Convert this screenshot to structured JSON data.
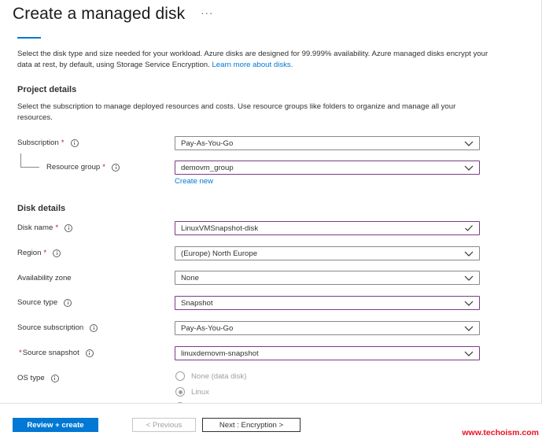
{
  "page": {
    "title": "Create a managed disk",
    "more_label": "···"
  },
  "intro": {
    "text": "Select the disk type and size needed for your workload. Azure disks are designed for 99.999% availability. Azure managed disks encrypt your data at rest, by default, using Storage Service Encryption.",
    "link": "Learn more about disks."
  },
  "project": {
    "heading": "Project details",
    "description": "Select the subscription to manage deployed resources and costs. Use resource groups like folders to organize and manage all your resources.",
    "subscription": {
      "label": "Subscription",
      "required": "*",
      "value": "Pay-As-You-Go"
    },
    "resource_group": {
      "label": "Resource group",
      "required": "*",
      "value": "demovm_group",
      "create_new": "Create new"
    }
  },
  "disk": {
    "heading": "Disk details",
    "disk_name": {
      "label": "Disk name",
      "required": "*",
      "value": "LinuxVMSnapshot-disk"
    },
    "region": {
      "label": "Region",
      "required": "*",
      "value": "(Europe) North Europe"
    },
    "availability_zone": {
      "label": "Availability zone",
      "value": "None"
    },
    "source_type": {
      "label": "Source type",
      "value": "Snapshot"
    },
    "source_subscription": {
      "label": "Source subscription",
      "value": "Pay-As-You-Go"
    },
    "source_snapshot": {
      "label": "Source snapshot",
      "required": "*",
      "value": "linuxdemovm-snapshot"
    },
    "os_type": {
      "label": "OS type",
      "options": [
        "None (data disk)",
        "Linux"
      ],
      "selected": "Linux"
    }
  },
  "footer": {
    "review_create": "Review + create",
    "previous": "< Previous",
    "next": "Next : Encryption >"
  },
  "watermark": "www.techoism.com",
  "colors": {
    "accent": "#0078d4",
    "focus_border": "#7a3b83",
    "required": "#a4262c",
    "watermark": "#e81123"
  }
}
